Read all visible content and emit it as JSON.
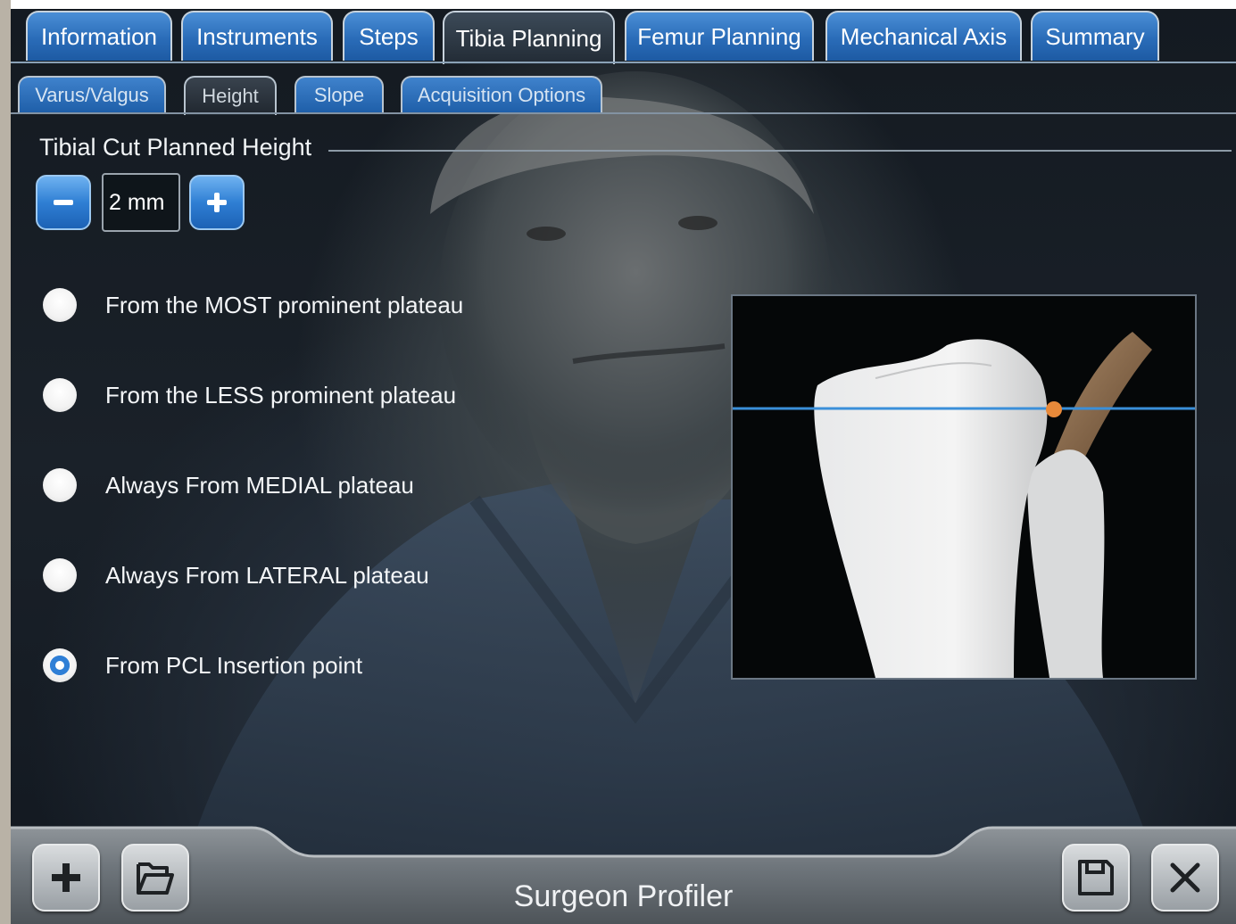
{
  "main_tabs": [
    {
      "label": "Information",
      "active": false
    },
    {
      "label": "Instruments",
      "active": false
    },
    {
      "label": "Steps",
      "active": false
    },
    {
      "label": "Tibia Planning",
      "active": true
    },
    {
      "label": "Femur Planning",
      "active": false
    },
    {
      "label": "Mechanical Axis",
      "active": false
    },
    {
      "label": "Summary",
      "active": false
    }
  ],
  "sub_tabs": [
    {
      "label": "Varus/Valgus",
      "active": false
    },
    {
      "label": "Height",
      "active": true
    },
    {
      "label": "Slope",
      "active": false
    },
    {
      "label": "Acquisition Options",
      "active": false
    }
  ],
  "section": {
    "title": "Tibial Cut Planned Height"
  },
  "stepper": {
    "value": "2 mm",
    "decrement_icon": "minus-icon",
    "increment_icon": "plus-icon"
  },
  "options": [
    {
      "label": "From the MOST prominent plateau",
      "selected": false
    },
    {
      "label": "From the LESS prominent plateau",
      "selected": false
    },
    {
      "label": "Always From MEDIAL plateau",
      "selected": false
    },
    {
      "label": "Always From LATERAL plateau",
      "selected": false
    },
    {
      "label": "From PCL Insertion point",
      "selected": true
    }
  ],
  "footer": {
    "title": "Surgeon Profiler",
    "left_buttons": [
      "plus-icon",
      "open-folder-icon"
    ],
    "right_buttons": [
      "save-icon",
      "close-icon"
    ]
  },
  "colors": {
    "tab_blue": "#2a6cb8",
    "radio_selected": "#2f7fd6",
    "cut_line": "#3a8fd9",
    "pcl_marker": "#e8893a"
  }
}
